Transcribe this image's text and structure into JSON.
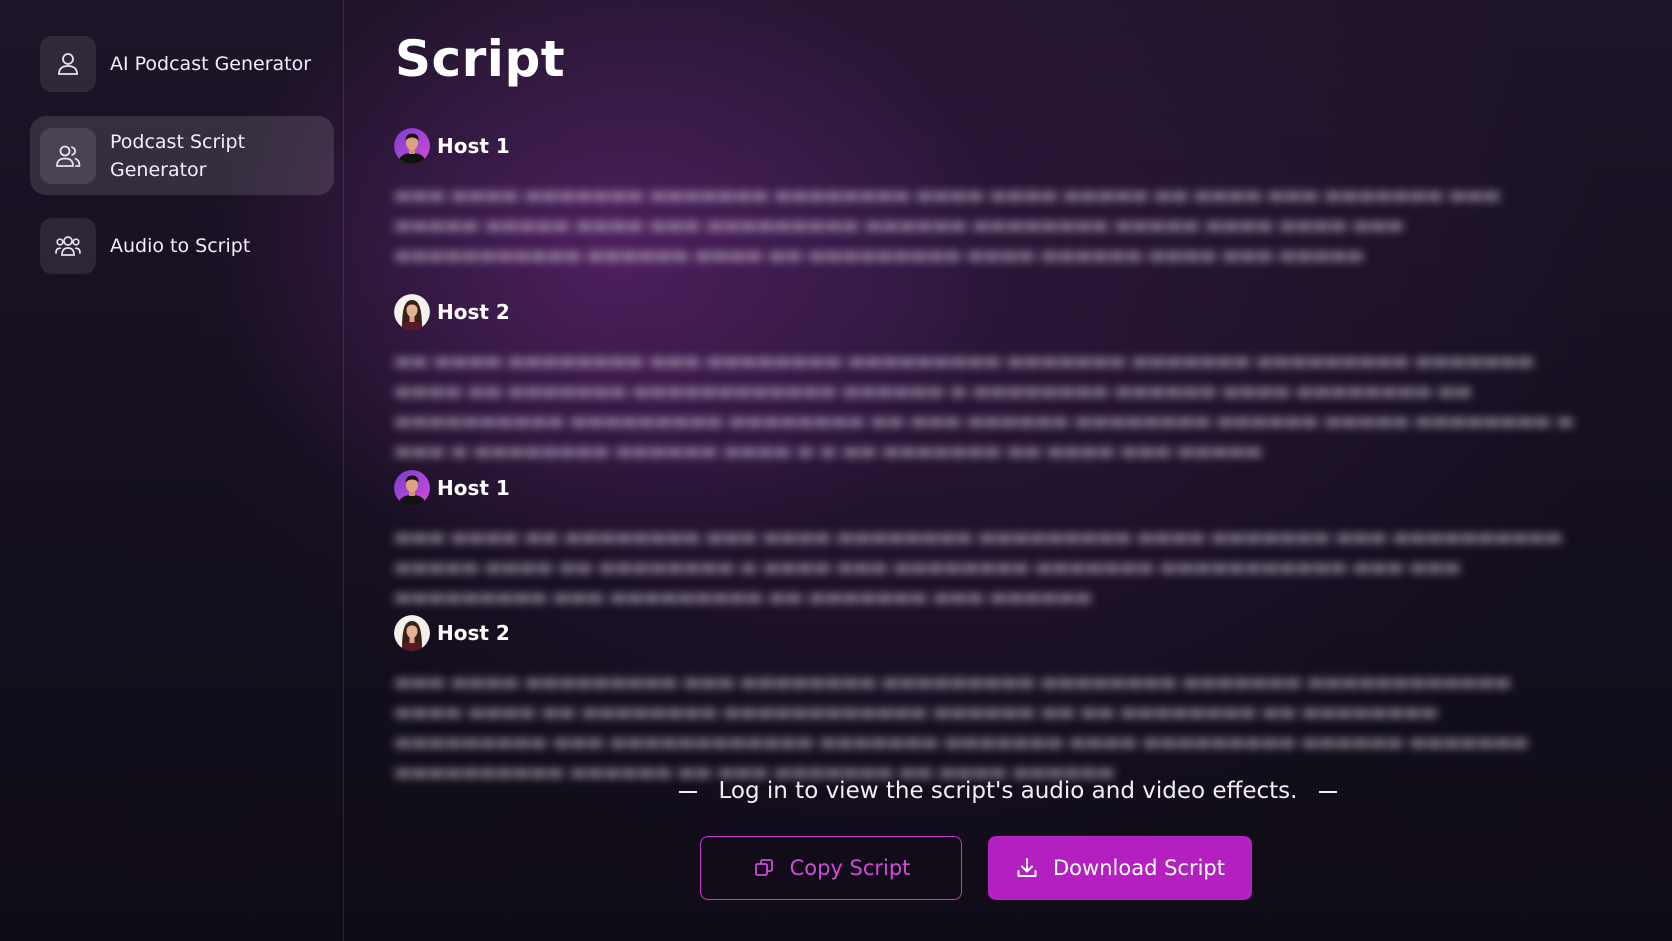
{
  "sidebar": {
    "items": [
      {
        "label": "AI Podcast Generator",
        "icon": "user-icon",
        "active": false
      },
      {
        "label": "Podcast Script Generator",
        "icon": "users-icon",
        "active": true
      },
      {
        "label": "Audio to Script",
        "icon": "user-group-icon",
        "active": false
      }
    ]
  },
  "main": {
    "title": "Script",
    "speakers": [
      {
        "name": "Host 1",
        "avatar": "host-1-avatar",
        "text": ""
      },
      {
        "name": "Host 2",
        "avatar": "host-2-avatar",
        "text": ""
      },
      {
        "name": "Host 1",
        "avatar": "host-1-avatar",
        "text": ""
      },
      {
        "name": "Host 2",
        "avatar": "host-2-avatar",
        "text": ""
      }
    ],
    "login_note": "Log in to view the script's audio and video effects.",
    "copy_label": "Copy Script",
    "download_label": "Download Script"
  },
  "colors": {
    "accent": "#b41fc2",
    "accent_text": "#d14bdb",
    "background": "#150f1e"
  }
}
